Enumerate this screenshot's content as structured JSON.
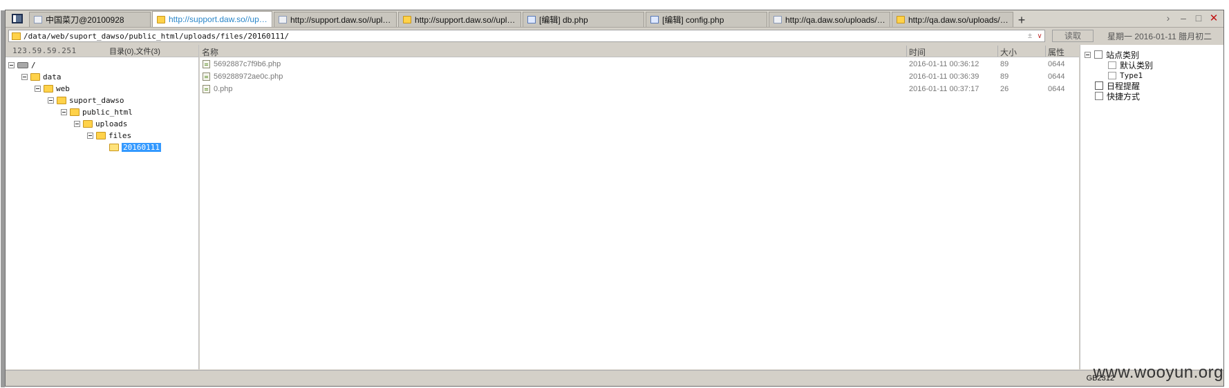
{
  "tabs": [
    {
      "label": "中国菜刀@20100928",
      "icon": "blank",
      "active": false
    },
    {
      "label": "http://support.daw.so//uploa...",
      "icon": "folder",
      "active": true
    },
    {
      "label": "http://support.daw.so//uploa...",
      "icon": "blank",
      "active": false
    },
    {
      "label": "http://support.daw.so//uploa...",
      "icon": "folder",
      "active": false
    },
    {
      "label": "[编辑] db.php",
      "icon": "doc",
      "active": false
    },
    {
      "label": "[编辑] config.php",
      "icon": "doc",
      "active": false
    },
    {
      "label": "http://qa.daw.so/uploads/file...",
      "icon": "blank",
      "active": false
    },
    {
      "label": "http://qa.daw.so/uploads/file...",
      "icon": "folder",
      "active": false
    }
  ],
  "address": {
    "path": "/data/web/suport_dawso/public_html/uploads/files/20160111/",
    "sort_glyph": "±",
    "read_label": "读取",
    "date": "星期一 2016-01-11 腊月初二"
  },
  "left": {
    "ip": "123.59.59.251",
    "counts": "目录(0),文件(3)",
    "tree": [
      {
        "label": "/",
        "kind": "drive",
        "depth": 0
      },
      {
        "label": "data",
        "kind": "folder",
        "depth": 1
      },
      {
        "label": "web",
        "kind": "folder",
        "depth": 2
      },
      {
        "label": "suport_dawso",
        "kind": "folder",
        "depth": 3
      },
      {
        "label": "public_html",
        "kind": "folder",
        "depth": 4
      },
      {
        "label": "uploads",
        "kind": "folder",
        "depth": 5
      },
      {
        "label": "files",
        "kind": "folder",
        "depth": 6
      },
      {
        "label": "20160111",
        "kind": "folder-open",
        "depth": 7,
        "selected": true
      }
    ]
  },
  "files": {
    "columns": {
      "name": "名称",
      "time": "时间",
      "size": "大小",
      "attr": "属性"
    },
    "rows": [
      {
        "name": "5692887c7f9b6.php",
        "time": "2016-01-11 00:36:12",
        "size": "89",
        "attr": "0644"
      },
      {
        "name": "569288972ae0c.php",
        "time": "2016-01-11 00:36:39",
        "size": "89",
        "attr": "0644"
      },
      {
        "name": "0.php",
        "time": "2016-01-11 00:37:17",
        "size": "26",
        "attr": "0644"
      }
    ]
  },
  "right": {
    "site_category": "站点类别",
    "default_category": "默认类别",
    "type1": "Type1",
    "schedule": "日程提醒",
    "shortcuts": "快捷方式"
  },
  "status": {
    "encoding": "GB2312"
  },
  "watermark": "www.wooyun.org"
}
